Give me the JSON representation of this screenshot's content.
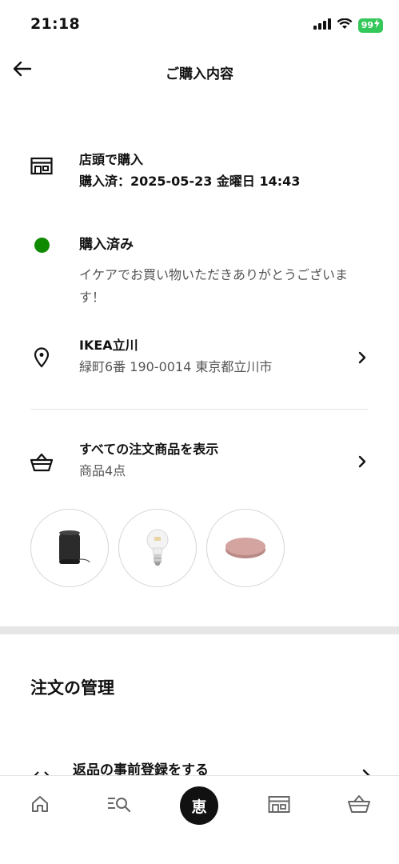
{
  "status_bar": {
    "time": "21:18",
    "battery": "99"
  },
  "nav": {
    "title": "ご購入内容"
  },
  "purchase": {
    "title": "店頭で購入",
    "date": "購入済：2025-05-23 金曜日 14:43"
  },
  "status": {
    "title": "購入済み",
    "message": "イケアでお買い物いただきありがとうございます！",
    "dot_color": "#108a00"
  },
  "store": {
    "name": "IKEA立川",
    "address": "緑町6番 190-0014 東京都立川市"
  },
  "items": {
    "title": "すべての注文商品を表示",
    "count": "商品4点"
  },
  "management": {
    "title": "注文の管理",
    "preregister_return": "返品の事前登録をする"
  },
  "tabs": {
    "center_label": "恵"
  }
}
